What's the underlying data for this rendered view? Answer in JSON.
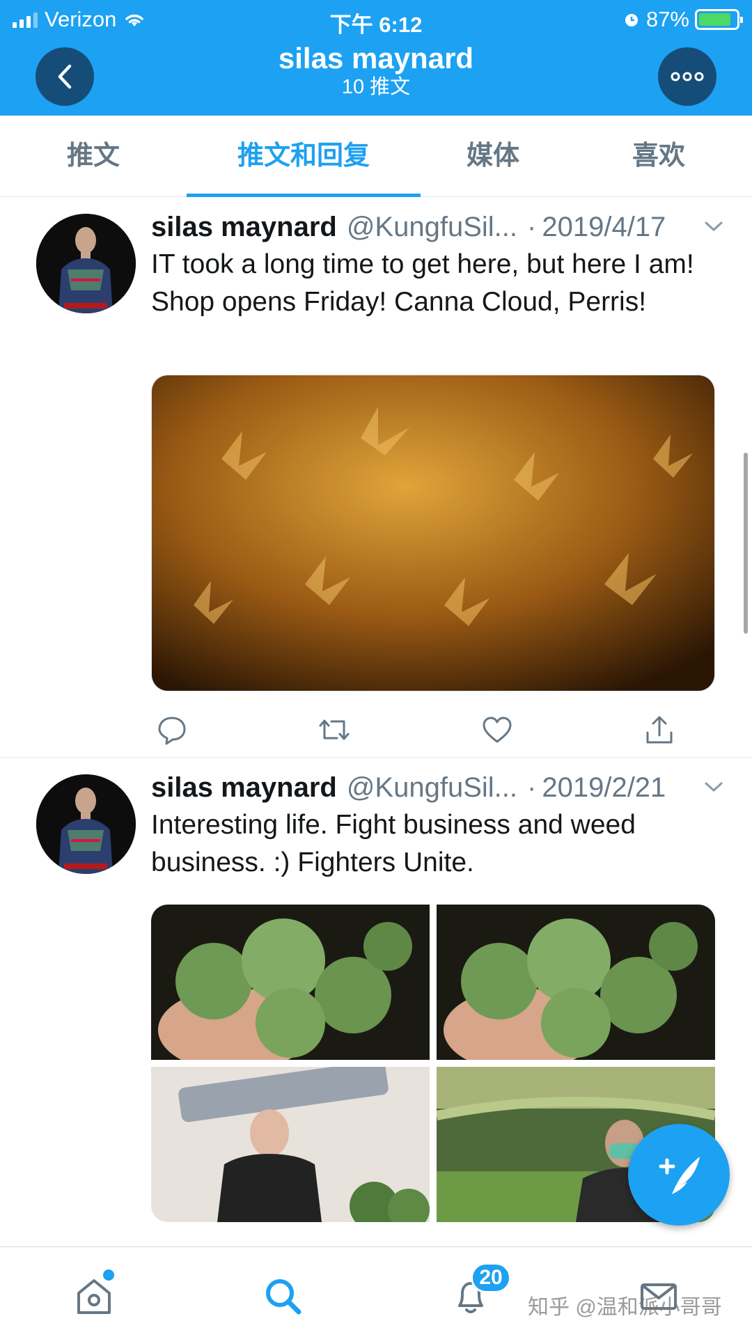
{
  "status_bar": {
    "carrier": "Verizon",
    "time": "下午 6:12",
    "battery": "87%",
    "battery_level": 0.87
  },
  "header": {
    "title": "silas maynard",
    "subtitle": "10 推文",
    "back_icon": "chevron-left-icon",
    "more_icon": "more-horizontal-icon"
  },
  "tabs": [
    {
      "label": "推文",
      "active": false
    },
    {
      "label": "推文和回复",
      "active": true
    },
    {
      "label": "媒体",
      "active": false
    },
    {
      "label": "喜欢",
      "active": false
    }
  ],
  "tweets": [
    {
      "name": "silas maynard",
      "handle": "@KungfuSil...",
      "separator": "·",
      "date": "2019/4/17",
      "text": "IT took a long time to get here, but here I am!  Shop opens Friday!   Canna Cloud, Perris!",
      "media_count": 1
    },
    {
      "name": "silas maynard",
      "handle": "@KungfuSil...",
      "separator": "·",
      "date": "2019/2/21",
      "text": "Interesting life.  Fight business and weed business.   :)  Fighters Unite.",
      "media_count": 4
    }
  ],
  "bottom_nav": {
    "notification_count": "20",
    "items": [
      "home-icon",
      "search-icon",
      "bell-icon",
      "mail-icon"
    ]
  },
  "fab": {
    "icon": "compose-tweet-icon"
  },
  "watermark": "知乎 @温和派小哥哥",
  "colors": {
    "accent": "#1da1f2",
    "header_button": "#164d78",
    "secondary_text": "#657786"
  }
}
